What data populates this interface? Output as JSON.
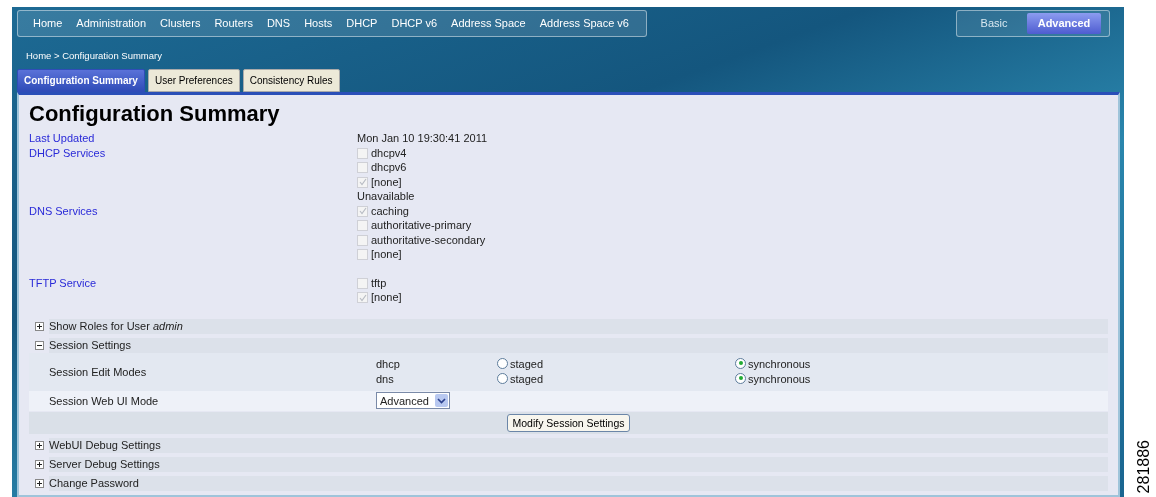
{
  "top_nav": [
    {
      "label": "Home"
    },
    {
      "label": "Administration"
    },
    {
      "label": "Clusters"
    },
    {
      "label": "Routers"
    },
    {
      "label": "DNS"
    },
    {
      "label": "Hosts"
    },
    {
      "label": "DHCP"
    },
    {
      "label": "DHCP v6"
    },
    {
      "label": "Address Space"
    },
    {
      "label": "Address Space v6"
    }
  ],
  "mode_switch": [
    {
      "label": "Basic",
      "selected": false
    },
    {
      "label": "Advanced",
      "selected": true
    }
  ],
  "breadcrumb": "Home > Configuration Summary",
  "tabs": [
    {
      "label": "Configuration Summary",
      "selected": true
    },
    {
      "label": "User Preferences",
      "selected": false
    },
    {
      "label": "Consistency Rules",
      "selected": false
    }
  ],
  "page_title": "Configuration Summary",
  "summary": [
    {
      "label": "Last Updated",
      "items": [
        {
          "kind": "text",
          "text": "Mon Jan 10 19:30:41 2011"
        }
      ]
    },
    {
      "label": "DHCP Services",
      "items": [
        {
          "kind": "checkbox",
          "text": "dhcpv4",
          "checked": false
        },
        {
          "kind": "checkbox",
          "text": "dhcpv6",
          "checked": false
        },
        {
          "kind": "checkbox",
          "text": "[none]",
          "checked": true
        },
        {
          "kind": "text",
          "text": "Unavailable"
        }
      ]
    },
    {
      "label": "DNS Services",
      "items": [
        {
          "kind": "checkbox",
          "text": "caching",
          "checked": true
        },
        {
          "kind": "checkbox",
          "text": "authoritative-primary",
          "checked": false
        },
        {
          "kind": "checkbox",
          "text": "authoritative-secondary",
          "checked": false
        },
        {
          "kind": "checkbox",
          "text": "[none]",
          "checked": false
        }
      ]
    },
    {
      "label": "TFTP Service",
      "items": [
        {
          "kind": "checkbox",
          "text": "tftp",
          "checked": false
        },
        {
          "kind": "checkbox",
          "text": "[none]",
          "checked": true
        }
      ]
    }
  ],
  "sections": [
    {
      "title": "Show Roles for User *admin*",
      "expanded": false
    },
    {
      "title": "Session Settings",
      "expanded": true,
      "content": {
        "edit_modes_label": "Session Edit Modes",
        "edit_modes": [
          {
            "service": "dhcp",
            "options": [
              {
                "label": "staged",
                "selected": false
              },
              {
                "label": "synchronous",
                "selected": true
              }
            ]
          },
          {
            "service": "dns",
            "options": [
              {
                "label": "staged",
                "selected": false
              },
              {
                "label": "synchronous",
                "selected": true
              }
            ]
          }
        ],
        "web_ui_mode_label": "Session Web UI Mode",
        "web_ui_mode": "Advanced",
        "submit": "Modify Session Settings"
      }
    },
    {
      "title": "WebUI Debug Settings",
      "expanded": false
    },
    {
      "title": "Server Debug Settings",
      "expanded": false
    },
    {
      "title": "Change Password",
      "expanded": false
    }
  ],
  "figure_number": "281886"
}
